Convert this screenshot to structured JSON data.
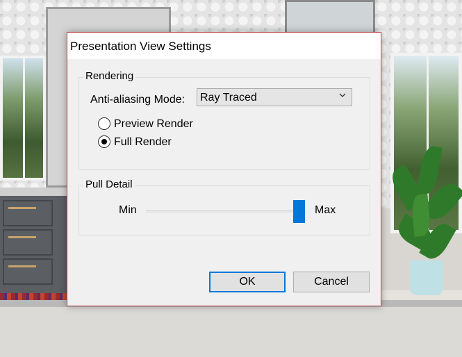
{
  "dialog": {
    "title": "Presentation View Settings",
    "rendering": {
      "legend": "Rendering",
      "aa_label": "Anti-aliasing Mode:",
      "aa_value": "Ray Traced",
      "options": [
        {
          "label": "Preview Render",
          "selected": false
        },
        {
          "label": "Full Render",
          "selected": true
        }
      ]
    },
    "pull_detail": {
      "legend": "Pull Detail",
      "min_label": "Min",
      "max_label": "Max",
      "value_fraction": 1.0
    },
    "buttons": {
      "ok": "OK",
      "cancel": "Cancel"
    }
  },
  "colors": {
    "accent": "#0078d7",
    "dialog_bg": "#f0f0f0",
    "border": "#b84a4a"
  }
}
